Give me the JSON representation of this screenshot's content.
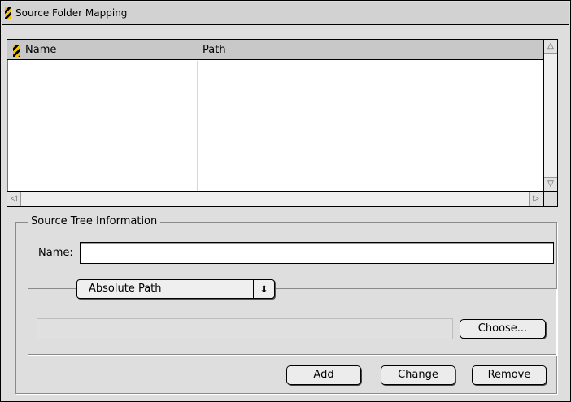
{
  "window": {
    "title": "Source Folder Mapping"
  },
  "list": {
    "columns": [
      "Name",
      "Path"
    ],
    "rows": []
  },
  "source_tree": {
    "group_label": "Source Tree Information",
    "name_label": "Name:",
    "name_value": "",
    "path_type": {
      "selected": "Absolute Path"
    },
    "path_value": "",
    "choose_label": "Choose..."
  },
  "actions": {
    "add_label": "Add",
    "change_label": "Change",
    "remove_label": "Remove"
  },
  "icons": {
    "title_badge": "hazard-stripe-icon",
    "header_badge": "hazard-stripe-icon",
    "scroll_up": "scroll-up-arrow-icon",
    "scroll_down": "scroll-down-arrow-icon",
    "scroll_left": "scroll-left-arrow-icon",
    "scroll_right": "scroll-right-arrow-icon",
    "popup_arrows": "updown-arrows-icon"
  }
}
